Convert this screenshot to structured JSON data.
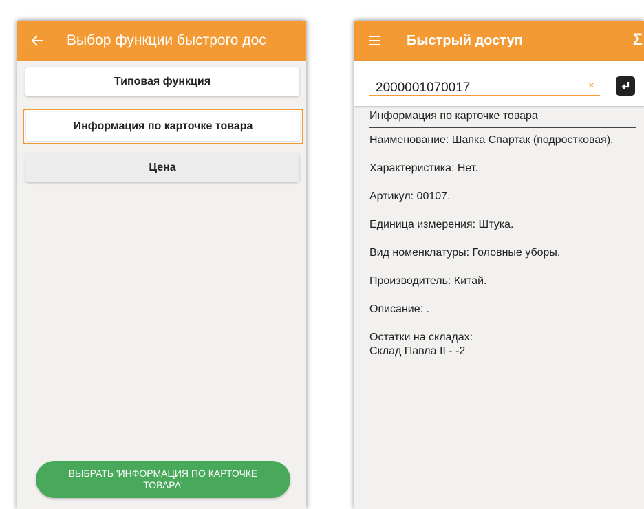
{
  "left": {
    "title": "Выбор функции быстрого дос",
    "options": [
      {
        "label": "Типовая функция"
      },
      {
        "label": "Информация по карточке товара"
      },
      {
        "label": "Цена"
      }
    ],
    "select_button": "ВЫБРАТЬ 'ИНФОРМАЦИЯ ПО КАРТОЧКЕ ТОВАРА'"
  },
  "right": {
    "title": "Быстрый доступ",
    "sigma": "Σ",
    "barcode_value": "2000001070017",
    "clear_glyph": "×",
    "info_header": "Информация по карточке товара",
    "lines": [
      {
        "text": "Наименование: Шапка Спартак (подростковая)."
      },
      {
        "text": "Характеристика: Нет."
      },
      {
        "text": "Артикул: 00107."
      },
      {
        "text": "Единица измерения: Штука."
      },
      {
        "text": "Вид номенклатуры:  Головные уборы."
      },
      {
        "text": "Производитель: Китай."
      },
      {
        "text": "Описание: ."
      },
      {
        "text": "Остатки на складах:"
      }
    ],
    "stock_line": "Склад Павла II - -2"
  },
  "colors": {
    "accent": "#f39a35",
    "button_green": "#49a95b",
    "background": "#f2f1ef"
  },
  "icons": [
    "back-arrow-icon",
    "menu-icon",
    "sigma-icon",
    "clear-icon",
    "enter-icon"
  ]
}
